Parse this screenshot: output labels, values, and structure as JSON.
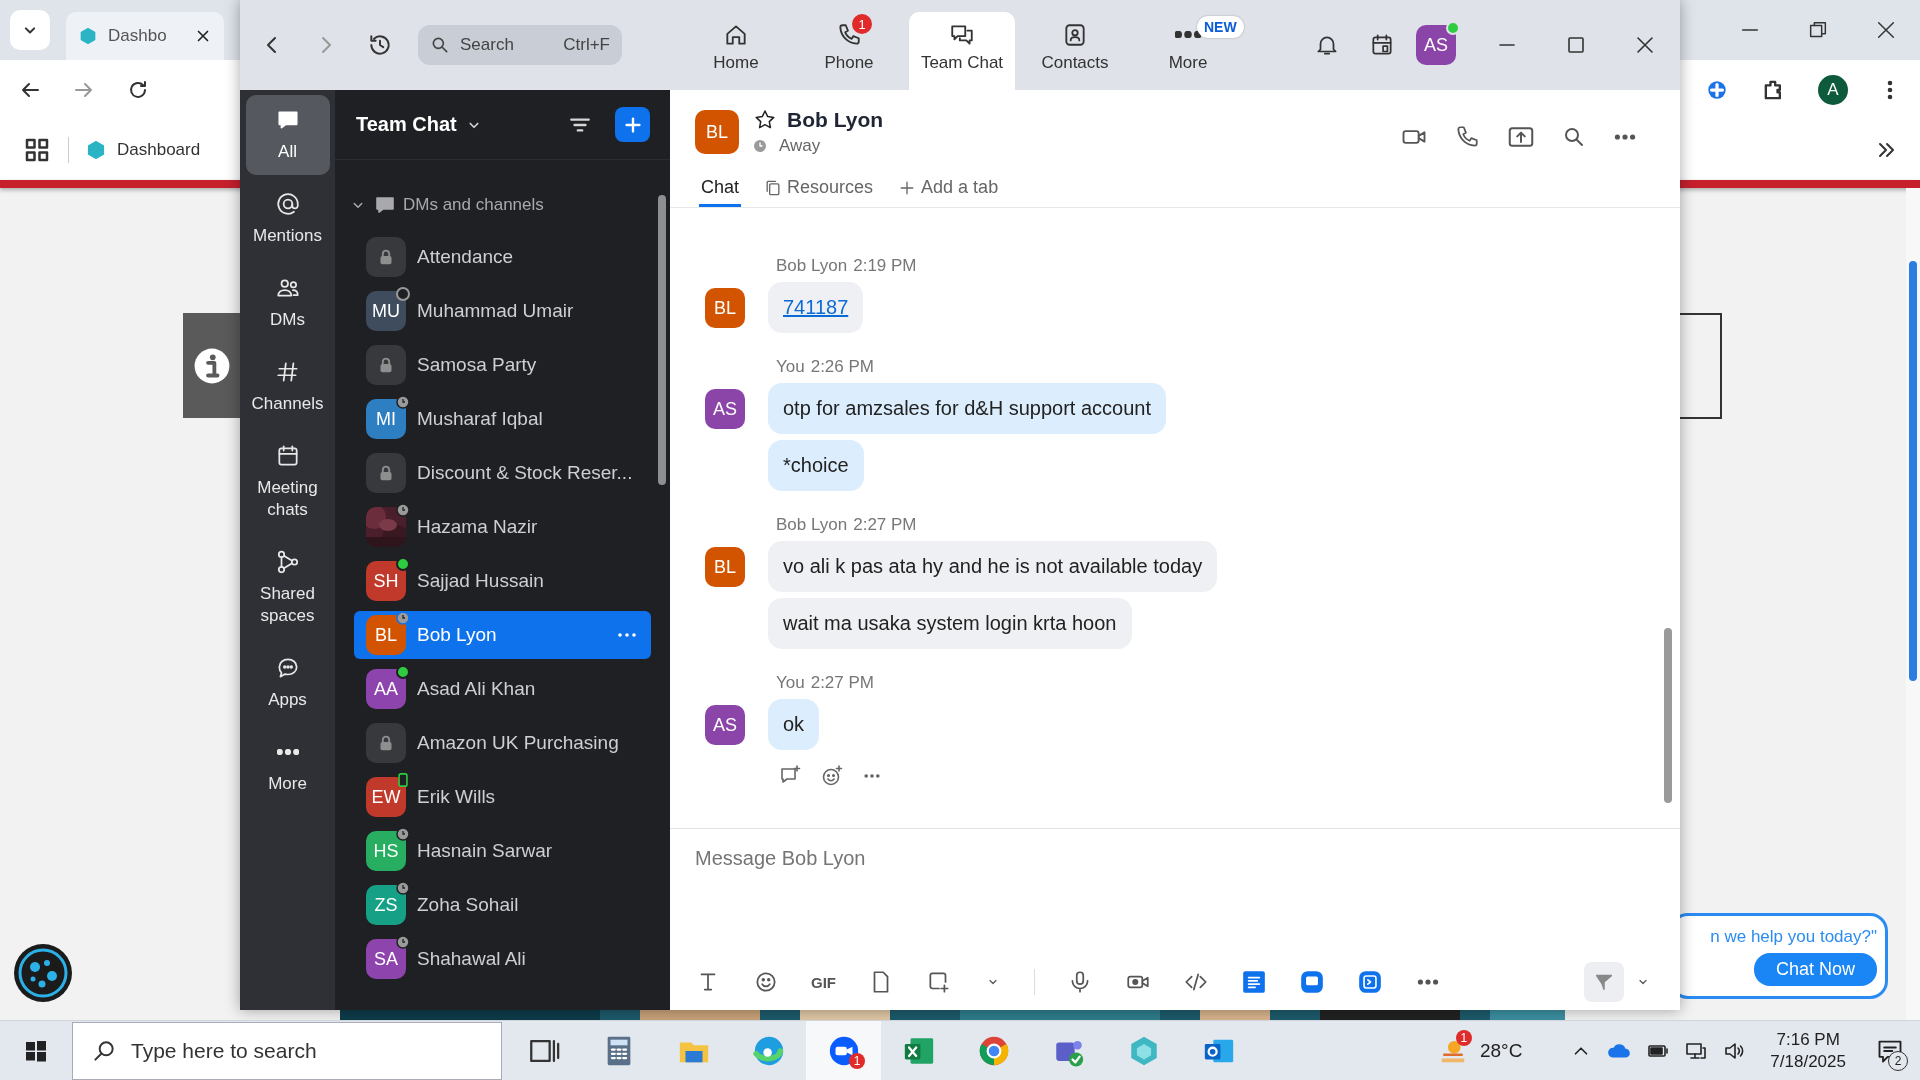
{
  "browser": {
    "tab_title": "Dashbo",
    "bookmark": "Dashboard",
    "profile_initial": "A"
  },
  "page": {
    "chat_prompt": "n we help you today?\"",
    "chat_button": "Chat Now"
  },
  "zoom": {
    "search": {
      "placeholder": "Search",
      "shortcut": "Ctrl+F"
    },
    "nav_tabs": [
      {
        "label": "Home",
        "selected": false
      },
      {
        "label": "Phone",
        "selected": false,
        "badge": {
          "kind": "count",
          "text": "1"
        }
      },
      {
        "label": "Team Chat",
        "selected": true
      },
      {
        "label": "Contacts",
        "selected": false
      },
      {
        "label": "More",
        "selected": false,
        "badge": {
          "kind": "label",
          "text": "NEW"
        }
      }
    ],
    "user": {
      "initials": "AS",
      "color": "#8b45a8",
      "status": {
        "kind": "online"
      }
    },
    "rail": [
      {
        "label": "All",
        "selected": true
      },
      {
        "label": "Mentions",
        "selected": false
      },
      {
        "label": "DMs",
        "selected": false
      },
      {
        "label": "Channels",
        "selected": false
      },
      {
        "label": "Meeting chats",
        "selected": false
      },
      {
        "label": "Shared spaces",
        "selected": false
      },
      {
        "label": "Apps",
        "selected": false
      },
      {
        "label": "More",
        "selected": false
      }
    ],
    "list": {
      "title": "Team Chat",
      "section": {
        "label": "DMs and channels",
        "expanded": true
      },
      "chats": [
        {
          "kind": "channel",
          "name": "Attendance",
          "selected": false
        },
        {
          "kind": "person",
          "initials": "MU",
          "color": "#3e4c5e",
          "status": {
            "kind": "offline"
          },
          "name": "Muhammad Umair",
          "selected": false
        },
        {
          "kind": "channel",
          "name": "Samosa Party",
          "selected": false
        },
        {
          "kind": "person",
          "initials": "MI",
          "color": "#2d7fc1",
          "status": {
            "kind": "away"
          },
          "name": "Musharaf Iqbal",
          "selected": false
        },
        {
          "kind": "channel",
          "name": "Discount & Stock Reser...",
          "selected": false
        },
        {
          "status": {
            "kind": "away"
          },
          "name": "Hazama Nazir",
          "selected": false
        },
        {
          "kind": "person",
          "initials": "SH",
          "color": "#c0392b",
          "status": {
            "kind": "online"
          },
          "name": "Sajjad Hussain",
          "selected": false
        },
        {
          "kind": "person",
          "initials": "BL",
          "color": "#d35400",
          "status": {
            "kind": "away"
          },
          "name": "Bob Lyon",
          "selected": true
        },
        {
          "kind": "person",
          "initials": "AA",
          "color": "#8e44ad",
          "status": {
            "kind": "online"
          },
          "name": "Asad Ali Khan",
          "selected": false
        },
        {
          "kind": "channel",
          "name": "Amazon UK Purchasing",
          "selected": false
        },
        {
          "kind": "person",
          "initials": "EW",
          "color": "#c0392b",
          "status": {
            "kind": "mobile"
          },
          "name": "Erik Wills",
          "selected": false
        },
        {
          "kind": "person",
          "initials": "HS",
          "color": "#27ae60",
          "status": {
            "kind": "away"
          },
          "name": "Hasnain Sarwar",
          "selected": false
        },
        {
          "kind": "person",
          "initials": "ZS",
          "color": "#16a085",
          "status": {
            "kind": "away"
          },
          "name": "Zoha Sohail",
          "selected": false
        },
        {
          "kind": "person",
          "initials": "SA",
          "color": "#8e44ad",
          "status": {
            "kind": "away"
          },
          "name": "Shahawal Ali",
          "selected": false
        }
      ]
    },
    "conversation": {
      "name": "Bob Lyon",
      "initials": "BL",
      "color": "#d35400",
      "starred": false,
      "status": "Away",
      "tabs": [
        {
          "label": "Chat",
          "selected": true
        },
        {
          "label": "Resources",
          "selected": false
        },
        {
          "label": "Add a tab",
          "selected": false
        }
      ],
      "groups": [
        {
          "sender": "Bob Lyon",
          "time": "2:19 PM",
          "initials": "BL",
          "color": "#d35400",
          "mine": false,
          "show_actions": false,
          "bubbles": [
            {
              "kind": "link",
              "text": "741187"
            }
          ]
        },
        {
          "sender": "You",
          "time": "2:26 PM",
          "initials": "AS",
          "color": "#8b45a8",
          "mine": true,
          "show_actions": false,
          "bubbles": [
            {
              "kind": "text",
              "text": "otp for amzsales for d&H support account"
            },
            {
              "kind": "text",
              "text": "*choice"
            }
          ]
        },
        {
          "sender": "Bob Lyon",
          "time": "2:27 PM",
          "initials": "BL",
          "color": "#d35400",
          "mine": false,
          "show_actions": false,
          "bubbles": [
            {
              "kind": "text",
              "text": "vo ali k pas ata hy and he is not available today"
            },
            {
              "kind": "text",
              "text": "wait ma usaka system login krta hoon"
            }
          ]
        },
        {
          "sender": "You",
          "time": "2:27 PM",
          "initials": "AS",
          "color": "#8b45a8",
          "mine": true,
          "show_actions": true,
          "bubbles": [
            {
              "kind": "text",
              "text": "ok"
            }
          ]
        }
      ],
      "composer": {
        "placeholder": "Message Bob Lyon",
        "gif_label": "GIF"
      }
    }
  },
  "taskbar": {
    "search_placeholder": "Type here to search",
    "apps": [
      {
        "kind": "task-view",
        "selected": false
      },
      {
        "kind": "calculator",
        "selected": false
      },
      {
        "kind": "folder",
        "selected": false
      },
      {
        "kind": "edge",
        "selected": false
      },
      {
        "kind": "zoom",
        "selected": true,
        "badge": "1"
      },
      {
        "kind": "excel",
        "selected": false
      },
      {
        "kind": "chrome",
        "selected": false
      },
      {
        "kind": "teams",
        "selected": false
      },
      {
        "kind": "hexagon",
        "selected": false
      },
      {
        "kind": "outlook",
        "selected": false
      }
    ],
    "weather": {
      "badge": "1",
      "temperature": "28°C"
    },
    "time": "7:16 PM",
    "date": "7/18/2025",
    "notifications": "2"
  }
}
